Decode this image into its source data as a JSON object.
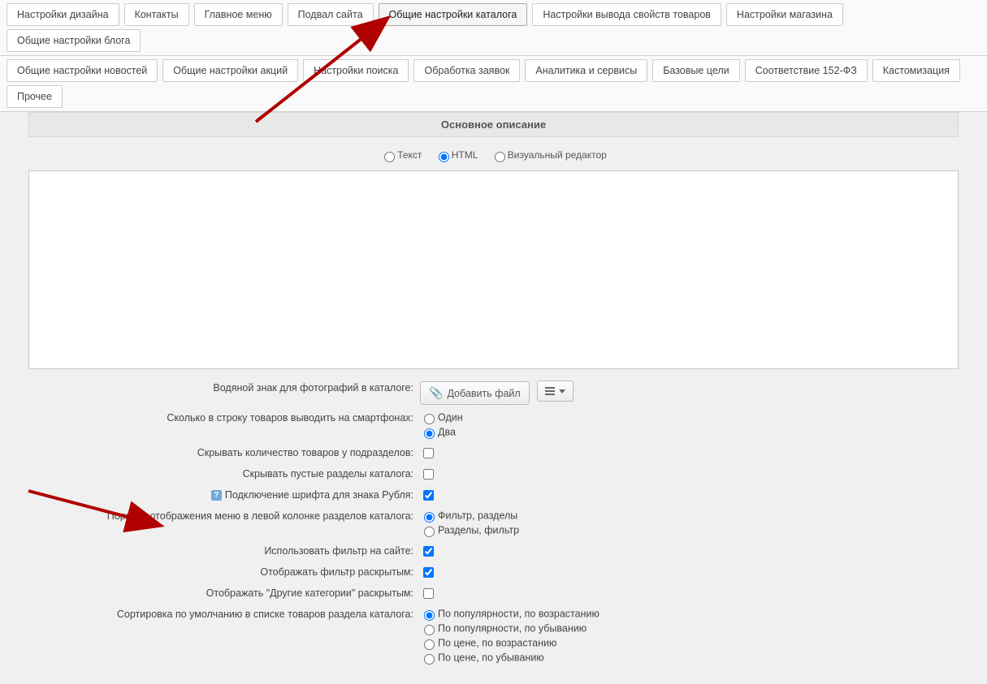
{
  "tabs_row1": [
    {
      "label": "Настройки дизайна",
      "active": false
    },
    {
      "label": "Контакты",
      "active": false
    },
    {
      "label": "Главное меню",
      "active": false
    },
    {
      "label": "Подвал сайта",
      "active": false
    },
    {
      "label": "Общие настройки каталога",
      "active": true
    },
    {
      "label": "Настройки вывода свойств товаров",
      "active": false
    },
    {
      "label": "Настройки магазина",
      "active": false
    },
    {
      "label": "Общие настройки блога",
      "active": false
    }
  ],
  "tabs_row2": [
    {
      "label": "Общие настройки новостей"
    },
    {
      "label": "Общие настройки акций"
    },
    {
      "label": "Настройки поиска"
    },
    {
      "label": "Обработка заявок"
    },
    {
      "label": "Аналитика и сервисы"
    },
    {
      "label": "Базовые цели"
    },
    {
      "label": "Соответствие 152-ФЗ"
    },
    {
      "label": "Кастомизация"
    },
    {
      "label": "Прочее"
    }
  ],
  "section": {
    "title": "Основное описание"
  },
  "editor_modes": {
    "text": "Текст",
    "html": "HTML",
    "visual": "Визуальный редактор",
    "selected": "html"
  },
  "watermark": {
    "label": "Водяной знак для фотографий в каталоге:",
    "button": "Добавить файл"
  },
  "smartphone": {
    "label": "Сколько в строку товаров выводить на смартфонах:",
    "one": "Один",
    "two": "Два",
    "selected": "two"
  },
  "hide_count": {
    "label": "Скрывать количество товаров у подразделов:",
    "checked": false
  },
  "hide_empty": {
    "label": "Скрывать пустые разделы каталога:",
    "checked": false
  },
  "ruble_font": {
    "label": "Подключение шрифта для знака Рубля:",
    "checked": true,
    "has_help": true
  },
  "menu_order": {
    "label": "Порядок отображения меню в левой колонке разделов каталога:",
    "opt1": "Фильтр, разделы",
    "opt2": "Разделы, фильтр",
    "selected": "opt1"
  },
  "use_filter": {
    "label": "Использовать фильтр на сайте:",
    "checked": true
  },
  "filter_open": {
    "label": "Отображать фильтр раскрытым:",
    "checked": true
  },
  "other_cat_open": {
    "label": "Отображать \"Другие категории\" раскрытым:",
    "checked": false
  },
  "default_sort": {
    "label": "Сортировка по умолчанию в списке товаров раздела каталога:",
    "opt1": "По популярности, по возрастанию",
    "opt2": "По популярности, по убыванию",
    "opt3": "По цене, по возрастанию",
    "opt4": "По цене, по убыванию",
    "selected": "opt1"
  }
}
